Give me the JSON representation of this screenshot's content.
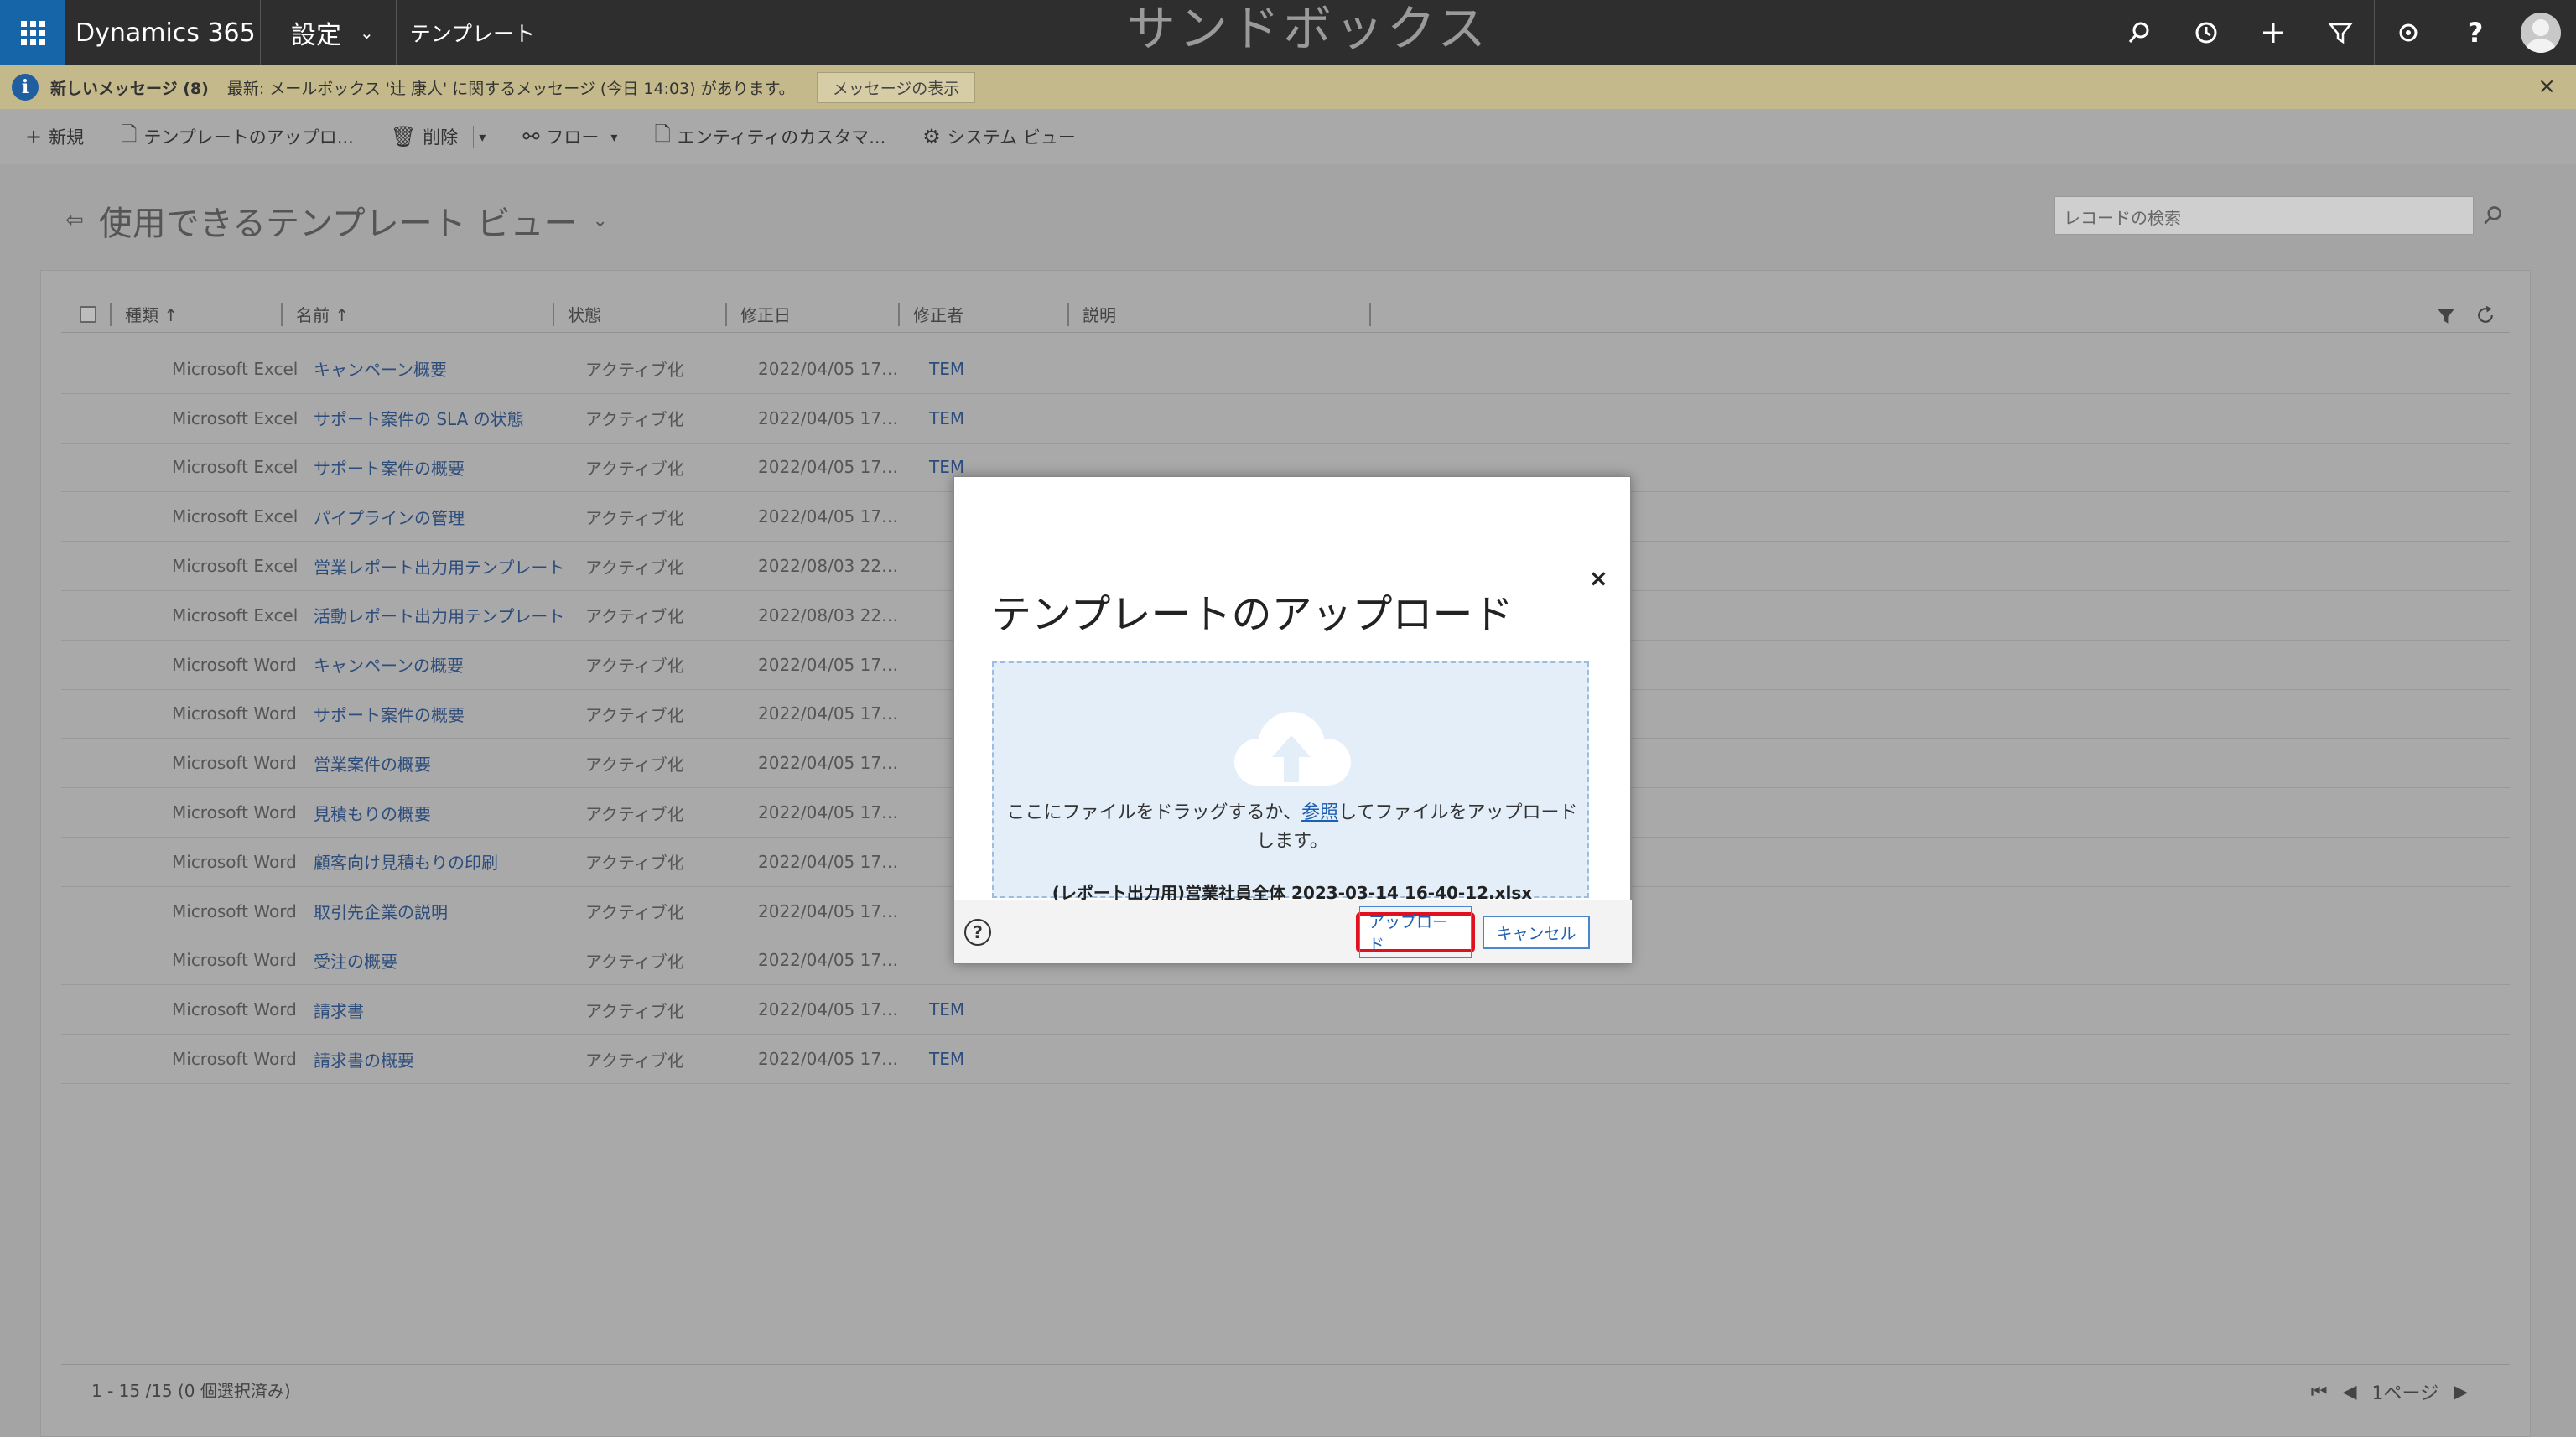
{
  "app": {
    "brand": "Dynamics 365",
    "area": "設定",
    "entity": "テンプレート",
    "environment_label": "サンドボックス"
  },
  "top_icons": [
    "search-icon",
    "history-icon",
    "plus-icon",
    "filter-icon",
    "settings-icon",
    "help-icon",
    "user-avatar"
  ],
  "notification": {
    "title": "新しいメッセージ (8)",
    "text": "最新: メールボックス '辻 康人' に関するメッセージ (今日 14:03) があります。",
    "button": "メッセージの表示",
    "close": "×"
  },
  "commands": [
    {
      "icon": "plus-icon",
      "glyph": "+",
      "label": "新規"
    },
    {
      "icon": "document-upload-icon",
      "glyph": "🗋",
      "label": "テンプレートのアップロ..."
    },
    {
      "icon": "trash-icon",
      "glyph": "🗑",
      "label": "削除",
      "caret": true
    },
    {
      "icon": "flow-icon",
      "glyph": "⚯",
      "label": "フロー",
      "caret": true
    },
    {
      "icon": "entity-customize-icon",
      "glyph": "🗋",
      "label": "エンティティのカスタマ..."
    },
    {
      "icon": "gear-icon",
      "glyph": "⚙",
      "label": "システム ビュー"
    }
  ],
  "view": {
    "title": "使用できるテンプレート ビュー",
    "search_placeholder": "レコードの検索"
  },
  "grid": {
    "columns": [
      "種類 ↑",
      "名前 ↑",
      "状態",
      "修正日",
      "修正者",
      "説明"
    ],
    "rows": [
      {
        "type": "Microsoft Excel",
        "name": "キャンペーン概要",
        "status": "アクティブ化",
        "date": "2022/04/05 17…",
        "by": "TEM"
      },
      {
        "type": "Microsoft Excel",
        "name": "サポート案件の SLA の状態",
        "status": "アクティブ化",
        "date": "2022/04/05 17…",
        "by": "TEM"
      },
      {
        "type": "Microsoft Excel",
        "name": "サポート案件の概要",
        "status": "アクティブ化",
        "date": "2022/04/05 17…",
        "by": "TEM"
      },
      {
        "type": "Microsoft Excel",
        "name": "パイプラインの管理",
        "status": "アクティブ化",
        "date": "2022/04/05 17…",
        "by": ""
      },
      {
        "type": "Microsoft Excel",
        "name": "営業レポート出力用テンプレート",
        "status": "アクティブ化",
        "date": "2022/08/03 22…",
        "by": ""
      },
      {
        "type": "Microsoft Excel",
        "name": "活動レポート出力用テンプレート",
        "status": "アクティブ化",
        "date": "2022/08/03 22…",
        "by": ""
      },
      {
        "type": "Microsoft Word",
        "name": "キャンペーンの概要",
        "status": "アクティブ化",
        "date": "2022/04/05 17…",
        "by": ""
      },
      {
        "type": "Microsoft Word",
        "name": "サポート案件の概要",
        "status": "アクティブ化",
        "date": "2022/04/05 17…",
        "by": ""
      },
      {
        "type": "Microsoft Word",
        "name": "営業案件の概要",
        "status": "アクティブ化",
        "date": "2022/04/05 17…",
        "by": ""
      },
      {
        "type": "Microsoft Word",
        "name": "見積もりの概要",
        "status": "アクティブ化",
        "date": "2022/04/05 17…",
        "by": ""
      },
      {
        "type": "Microsoft Word",
        "name": "顧客向け見積もりの印刷",
        "status": "アクティブ化",
        "date": "2022/04/05 17…",
        "by": ""
      },
      {
        "type": "Microsoft Word",
        "name": "取引先企業の説明",
        "status": "アクティブ化",
        "date": "2022/04/05 17…",
        "by": ""
      },
      {
        "type": "Microsoft Word",
        "name": "受注の概要",
        "status": "アクティブ化",
        "date": "2022/04/05 17…",
        "by": ""
      },
      {
        "type": "Microsoft Word",
        "name": "請求書",
        "status": "アクティブ化",
        "date": "2022/04/05 17…",
        "by": "TEM"
      },
      {
        "type": "Microsoft Word",
        "name": "請求書の概要",
        "status": "アクティブ化",
        "date": "2022/04/05 17…",
        "by": "TEM"
      }
    ],
    "footer_count": "1 - 15 /15 (0 個選択済み)",
    "page_label": "1ページ"
  },
  "modal": {
    "title": "テンプレートのアップロード",
    "close": "×",
    "drop_text_before": "ここにファイルをドラッグするか、",
    "drop_link": "参照",
    "drop_text_after": "してファイルをアップロードします。",
    "file_name": "(レポート出力用)営業社員全体 2023-03-14 16-40-12.xlsx",
    "help": "?",
    "upload_button": "アップロード",
    "cancel_button": "キャンセル"
  },
  "colors": {
    "nav_bar": "#2e2e2e",
    "waffle_accent": "#1565a8",
    "notification_bg": "#c4b98a",
    "link_blue": "#1d5fb0",
    "upload_highlight": "#e01020"
  }
}
